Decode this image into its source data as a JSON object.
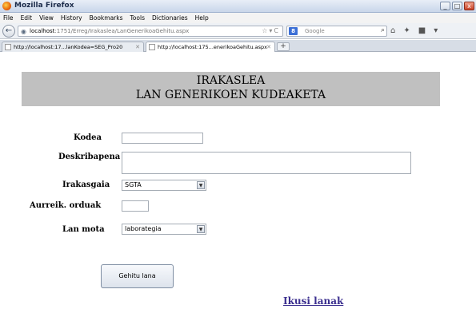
{
  "window": {
    "title": "Mozilla Firefox",
    "min": "_",
    "max": "□",
    "close": "x"
  },
  "menu": [
    "File",
    "Edit",
    "View",
    "History",
    "Bookmarks",
    "Tools",
    "Dictionaries",
    "Help"
  ],
  "nav": {
    "url_host": "localhost",
    "url_rest": ":1751/Erreg/Irakaslea/LanGenerikoaGehitu.aspx",
    "search_engine": "Google",
    "search_placeholder": "Google"
  },
  "tabs": [
    {
      "label": "http://localhost:17...lanKodea=SEG_Pro20"
    },
    {
      "label": "http://localhost:175...enerikoaGehitu.aspx"
    }
  ],
  "page": {
    "header_line1": "IRAKASLEA",
    "header_line2": "LAN GENERIKOEN KUDEAKETA",
    "labels": {
      "kodea": "Kodea",
      "deskribapena": "Deskribapena",
      "irakasgaia": "Irakasgaia",
      "aurreik": "Aurreik. orduak",
      "lan_mota": "Lan mota"
    },
    "values": {
      "kodea": "",
      "deskribapena": "",
      "irakasgaia": "SGTA",
      "aurreik": "",
      "lan_mota": "laborategia"
    },
    "submit_label": "Gehitu lana",
    "link_label": "Ikusi lanak"
  },
  "colors": {
    "header_bg": "#c0c0c0",
    "link": "#3b2f8f"
  }
}
